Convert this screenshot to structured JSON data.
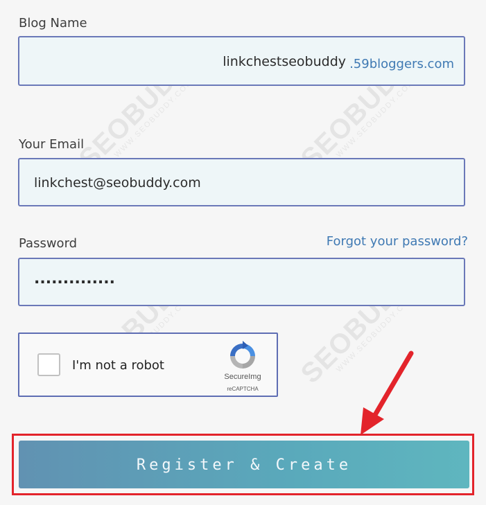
{
  "blog_name": {
    "label": "Blog Name",
    "value": "linkchestseobuddy",
    "domain_suffix": ".59bloggers.com"
  },
  "email": {
    "label": "Your Email",
    "value": "linkchest@seobuddy.com"
  },
  "password": {
    "label": "Password",
    "masked_value": "..............",
    "forgot_link": "Forgot your password?"
  },
  "captcha": {
    "label": "I'm not a robot",
    "brand": "SecureImg",
    "sub": "reCAPTCHA",
    "checked": false
  },
  "submit_button": {
    "label": "Register & Create"
  },
  "watermark": {
    "text": "SEOBUDDY",
    "sub": "WWW.SEOBUDDY.COM"
  },
  "colors": {
    "field_border": "#6a78b8",
    "link": "#3f79b3",
    "highlight": "#e3242b",
    "button_start": "#6192b2",
    "button_end": "#5fb6bf"
  },
  "icons": {
    "captcha_logo": "recaptcha-logo-icon",
    "annotation_arrow": "red-arrow-icon"
  }
}
